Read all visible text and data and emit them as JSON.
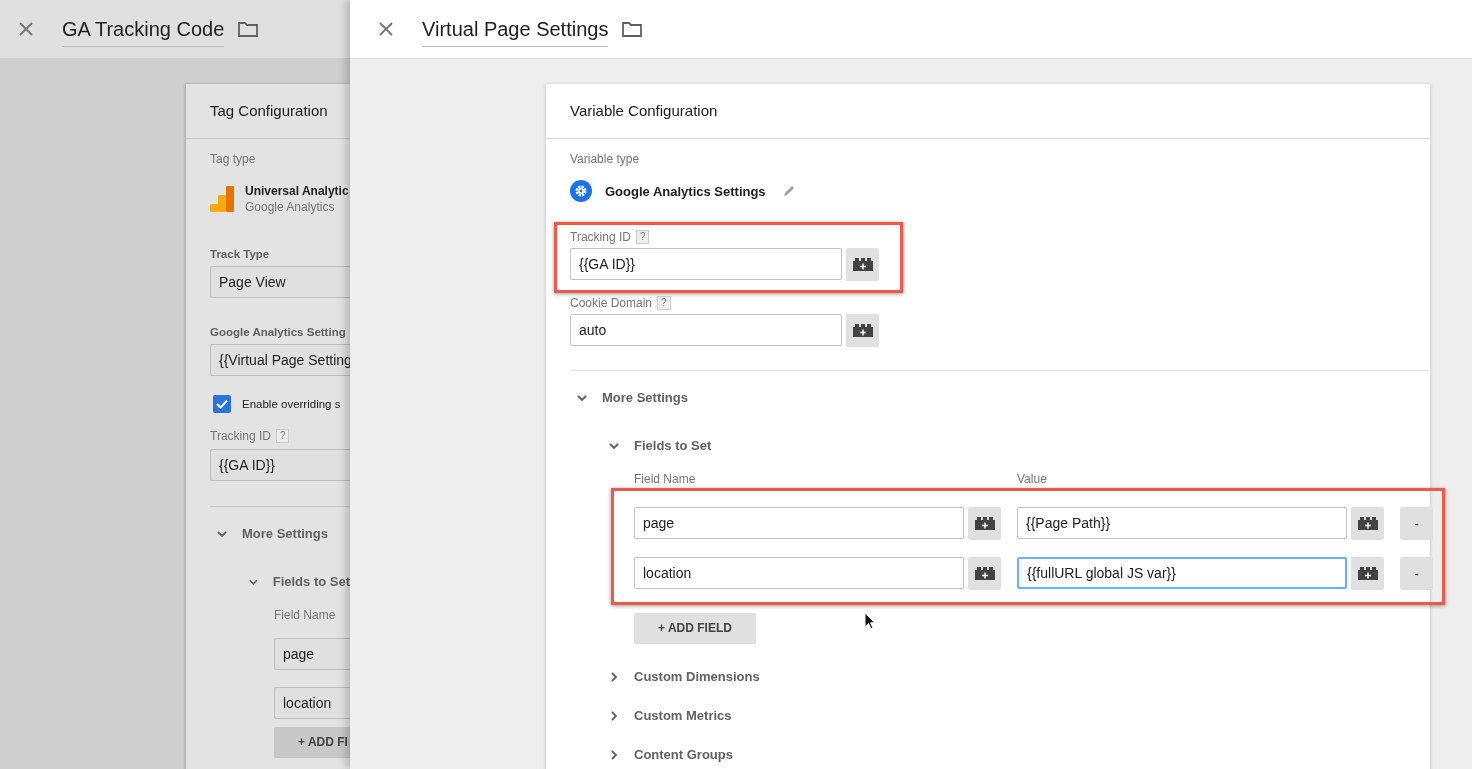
{
  "back_panel": {
    "title": "GA Tracking Code",
    "card": {
      "title": "Tag Configuration",
      "tag_type_label": "Tag type",
      "tag_type": {
        "name": "Universal Analytic",
        "vendor": "Google Analytics"
      },
      "track_type": {
        "label": "Track Type",
        "value": "Page View"
      },
      "ga_settings": {
        "label": "Google Analytics Setting",
        "value": "{{Virtual Page Setting"
      },
      "override": {
        "label": "Enable overriding s",
        "checked": true
      },
      "tracking_id": {
        "label": "Tracking ID",
        "help": "?",
        "value": "{{GA ID}}"
      },
      "more_settings": {
        "label": "More Settings",
        "expanded": true
      },
      "fields_to_set": {
        "label": "Fields to Set",
        "expanded": true,
        "column": "Field Name",
        "rows": [
          "page",
          "location"
        ],
        "add_button": "+ ADD FI"
      }
    }
  },
  "front_panel": {
    "title": "Virtual Page Settings",
    "card": {
      "title": "Variable Configuration",
      "variable_type_label": "Variable type",
      "variable_type": "Google Analytics Settings",
      "fields": [
        {
          "label": "Tracking ID",
          "help": "?",
          "value": "{{GA ID}}",
          "highlighted": true
        },
        {
          "label": "Cookie Domain",
          "help": "?",
          "value": "auto",
          "highlighted": false
        }
      ],
      "more_settings": {
        "label": "More Settings",
        "expanded": true
      },
      "fields_to_set": {
        "label": "Fields to Set",
        "expanded": true,
        "highlighted": true,
        "columns": [
          "Field Name",
          "Value"
        ],
        "rows": [
          {
            "name": "page",
            "value": "{{Page Path}}",
            "focused": false,
            "remove": "-"
          },
          {
            "name": "location",
            "value": "{{fullURL global JS var}}",
            "focused": true,
            "remove": "-"
          }
        ],
        "add_button": "+ ADD FIELD"
      },
      "sections": [
        {
          "label": "Custom Dimensions",
          "expanded": false
        },
        {
          "label": "Custom Metrics",
          "expanded": false
        },
        {
          "label": "Content Groups",
          "expanded": false
        }
      ]
    }
  }
}
